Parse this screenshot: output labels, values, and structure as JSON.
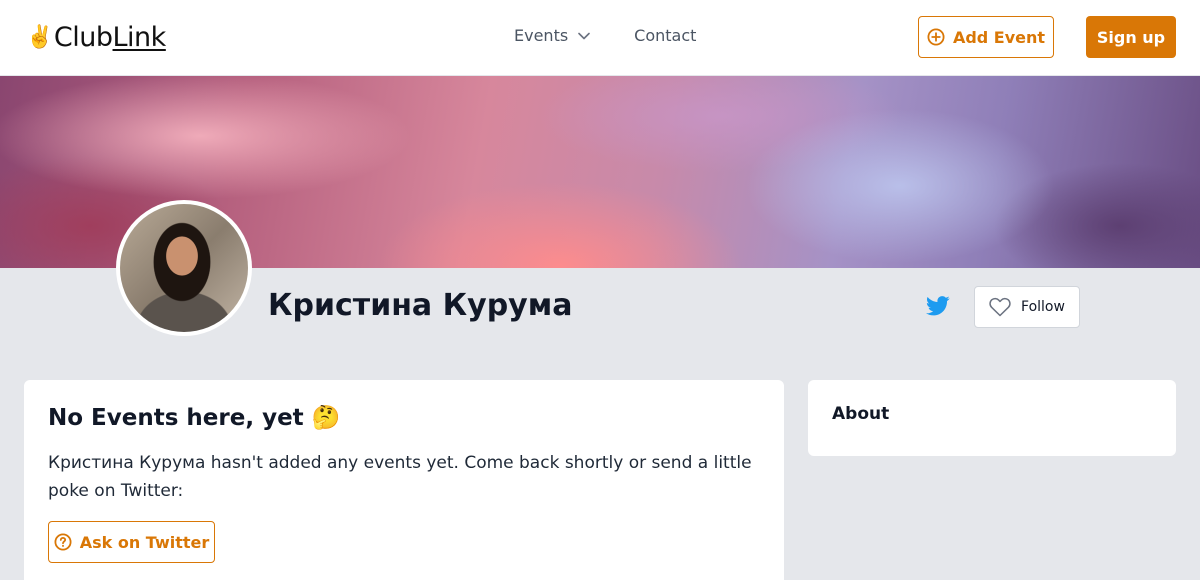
{
  "header": {
    "logo_hand": "✌️",
    "logo_club": "Club",
    "logo_link": "Link",
    "nav_events": "Events",
    "nav_contact": "Contact",
    "add_event_label": "Add Event",
    "signup_label": "Sign up"
  },
  "profile": {
    "name": "Кристина Курума",
    "follow_label": "Follow"
  },
  "events_card": {
    "title": "No Events here, yet",
    "title_emoji": "🤔",
    "message": "Кристина Курума hasn't added any events yet. Come back shortly or send a little poke on Twitter:",
    "ask_label": "Ask on Twitter"
  },
  "about_card": {
    "title": "About"
  },
  "colors": {
    "accent": "#d97706",
    "twitter": "#1d9bf0",
    "page_bg": "#e5e7eb"
  }
}
